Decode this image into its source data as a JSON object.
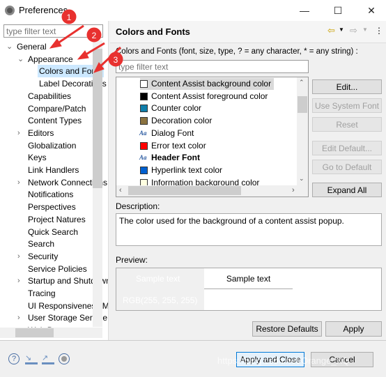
{
  "window": {
    "title": "Preferences",
    "minimize": "—",
    "maximize": "☐",
    "close": "✕"
  },
  "left": {
    "filter_placeholder": "type filter text",
    "tree": [
      {
        "label": "General",
        "level": 0,
        "twisty": "v"
      },
      {
        "label": "Appearance",
        "level": 1,
        "twisty": "v"
      },
      {
        "label": "Colors and Fonts",
        "level": 2,
        "twisty": "",
        "selected": true
      },
      {
        "label": "Label Decorations",
        "level": 2,
        "twisty": ""
      },
      {
        "label": "Capabilities",
        "level": 1,
        "twisty": ""
      },
      {
        "label": "Compare/Patch",
        "level": 1,
        "twisty": ""
      },
      {
        "label": "Content Types",
        "level": 1,
        "twisty": ""
      },
      {
        "label": "Editors",
        "level": 1,
        "twisty": ">"
      },
      {
        "label": "Globalization",
        "level": 1,
        "twisty": ""
      },
      {
        "label": "Keys",
        "level": 1,
        "twisty": ""
      },
      {
        "label": "Link Handlers",
        "level": 1,
        "twisty": ""
      },
      {
        "label": "Network Connections",
        "level": 1,
        "twisty": ">"
      },
      {
        "label": "Notifications",
        "level": 1,
        "twisty": ""
      },
      {
        "label": "Perspectives",
        "level": 1,
        "twisty": ""
      },
      {
        "label": "Project Natures",
        "level": 1,
        "twisty": ""
      },
      {
        "label": "Quick Search",
        "level": 1,
        "twisty": ""
      },
      {
        "label": "Search",
        "level": 1,
        "twisty": ""
      },
      {
        "label": "Security",
        "level": 1,
        "twisty": ">"
      },
      {
        "label": "Service Policies",
        "level": 1,
        "twisty": ""
      },
      {
        "label": "Startup and Shutdown",
        "level": 1,
        "twisty": ">"
      },
      {
        "label": "Tracing",
        "level": 1,
        "twisty": ""
      },
      {
        "label": "UI Responsiveness Monitoring",
        "level": 1,
        "twisty": ""
      },
      {
        "label": "User Storage Service",
        "level": 1,
        "twisty": ">"
      },
      {
        "label": "Web Browser",
        "level": 1,
        "twisty": ""
      }
    ]
  },
  "right": {
    "title": "Colors and Fonts",
    "nav_back": "⇦",
    "nav_fwd": "⇨",
    "menu": "⋮",
    "filter_label": "Colors and Fonts (font, size, type, ? = any character, * = any string) :",
    "filter_placeholder": "type filter text",
    "items": [
      {
        "label": "Content Assist background color",
        "kind": "color",
        "color": "#ffffff",
        "selected": true
      },
      {
        "label": "Content Assist foreground color",
        "kind": "color",
        "color": "#000000"
      },
      {
        "label": "Counter color",
        "kind": "color",
        "color": "#0f7eaa"
      },
      {
        "label": "Decoration color",
        "kind": "color",
        "color": "#8b7340"
      },
      {
        "label": "Dialog Font",
        "kind": "font",
        "icon": "Aa"
      },
      {
        "label": "Error text color",
        "kind": "color",
        "color": "#ff0000"
      },
      {
        "label": "Header Font",
        "kind": "font",
        "icon": "Aa",
        "bold": true
      },
      {
        "label": "Hyperlink text color",
        "kind": "color",
        "color": "#0060d0"
      },
      {
        "label": "Information background color",
        "kind": "color",
        "color": "#ffffe1"
      }
    ],
    "buttons": {
      "edit": "Edit...",
      "use_system_font": "Use System Font",
      "reset": "Reset",
      "edit_default": "Edit Default...",
      "go_to_default": "Go to Default",
      "expand_all": "Expand All"
    },
    "description_label": "Description:",
    "description": "The color used for the background of a content assist popup.",
    "preview_label": "Preview:",
    "preview_sample_dark": "Sample text",
    "preview_rgb": "RGB(255, 255, 255)",
    "preview_sample_light": "Sample text",
    "restore_defaults": "Restore Defaults",
    "apply": "Apply"
  },
  "footer": {
    "apply_close": "Apply and Close",
    "cancel": "Cancel",
    "watermark": "https://blog.csdn.net/Orange_XQ"
  },
  "annotations": [
    "1",
    "2",
    "3"
  ],
  "colors": {
    "annotation": "#e8312f",
    "selection": "#cce8ff",
    "focus": "#0078d7"
  }
}
